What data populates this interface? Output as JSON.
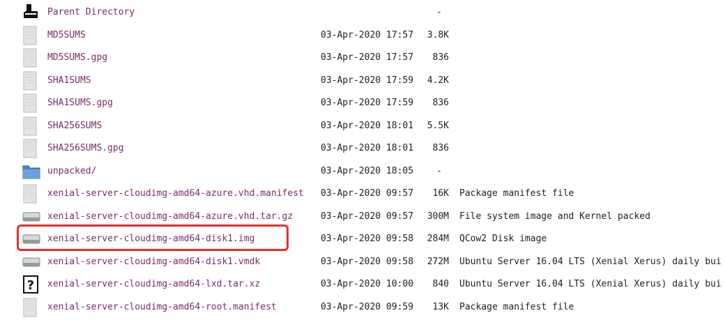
{
  "listing": {
    "parent": {
      "name": "Parent Directory",
      "size": "-",
      "icon": "back-arrow-icon"
    },
    "rows": [
      {
        "name": "MD5SUMS",
        "date": "03-Apr-2020 17:57",
        "size": "3.8K",
        "desc": "",
        "icon": "file-icon"
      },
      {
        "name": "MD5SUMS.gpg",
        "date": "03-Apr-2020 17:57",
        "size": "836",
        "desc": "",
        "icon": "file-icon"
      },
      {
        "name": "SHA1SUMS",
        "date": "03-Apr-2020 17:59",
        "size": "4.2K",
        "desc": "",
        "icon": "file-icon"
      },
      {
        "name": "SHA1SUMS.gpg",
        "date": "03-Apr-2020 17:59",
        "size": "836",
        "desc": "",
        "icon": "file-icon"
      },
      {
        "name": "SHA256SUMS",
        "date": "03-Apr-2020 18:01",
        "size": "5.5K",
        "desc": "",
        "icon": "file-icon"
      },
      {
        "name": "SHA256SUMS.gpg",
        "date": "03-Apr-2020 18:01",
        "size": "836",
        "desc": "",
        "icon": "file-icon"
      },
      {
        "name": "unpacked/",
        "date": "03-Apr-2020 18:05",
        "size": "-",
        "desc": "",
        "icon": "folder-icon"
      },
      {
        "name": "xenial-server-cloudimg-amd64-azure.vhd.manifest",
        "date": "03-Apr-2020 09:57",
        "size": "16K",
        "desc": "Package manifest file",
        "icon": "file-icon"
      },
      {
        "name": "xenial-server-cloudimg-amd64-azure.vhd.tar.gz",
        "date": "03-Apr-2020 09:57",
        "size": "300M",
        "desc": "File system image and Kernel packed",
        "icon": "disk-icon"
      },
      {
        "name": "xenial-server-cloudimg-amd64-disk1.img",
        "date": "03-Apr-2020 09:58",
        "size": "284M",
        "desc": "QCow2 Disk image",
        "icon": "disk-icon"
      },
      {
        "name": "xenial-server-cloudimg-amd64-disk1.vmdk",
        "date": "03-Apr-2020 09:58",
        "size": "272M",
        "desc": "Ubuntu Server 16.04 LTS (Xenial Xerus) daily bui",
        "icon": "disk-icon"
      },
      {
        "name": "xenial-server-cloudimg-amd64-lxd.tar.xz",
        "date": "03-Apr-2020 10:00",
        "size": "840",
        "desc": "Ubuntu Server 16.04 LTS (Xenial Xerus) daily bui",
        "icon": "unknown-file-icon"
      },
      {
        "name": "xenial-server-cloudimg-amd64-root.manifest",
        "date": "03-Apr-2020 09:59",
        "size": "13K",
        "desc": "Package manifest file",
        "icon": "file-icon"
      }
    ]
  },
  "colors": {
    "link": "#7a2b6b",
    "highlight": "#ee2a2a",
    "folder": "#4a86c8"
  }
}
